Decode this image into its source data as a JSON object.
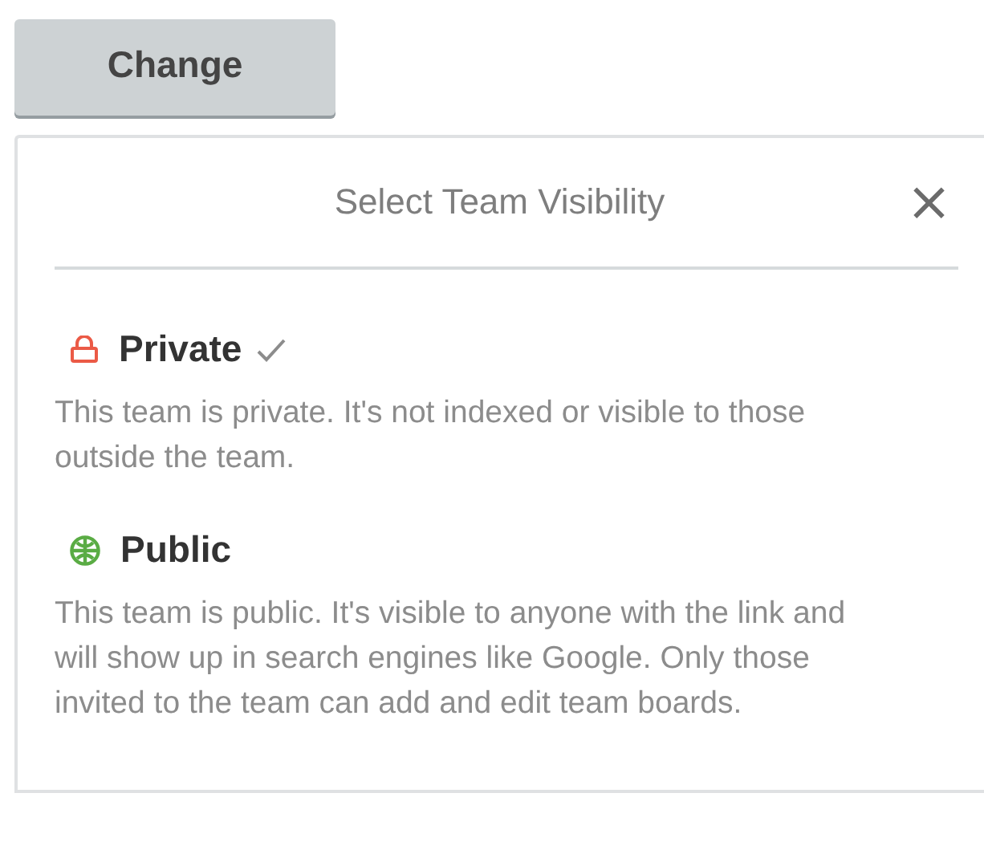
{
  "button": {
    "label": "Change"
  },
  "popover": {
    "title": "Select Team Visibility",
    "close": "×",
    "options": [
      {
        "kind": "lock",
        "title": "Private",
        "selected": true,
        "description": "This team is private. It's not indexed or visible to those outside the team."
      },
      {
        "kind": "globe",
        "title": "Public",
        "selected": false,
        "description": "This team is public. It's visible to anyone with the link and will show up in search engines like Google. Only those invited to the team can add and edit team boards."
      }
    ]
  }
}
